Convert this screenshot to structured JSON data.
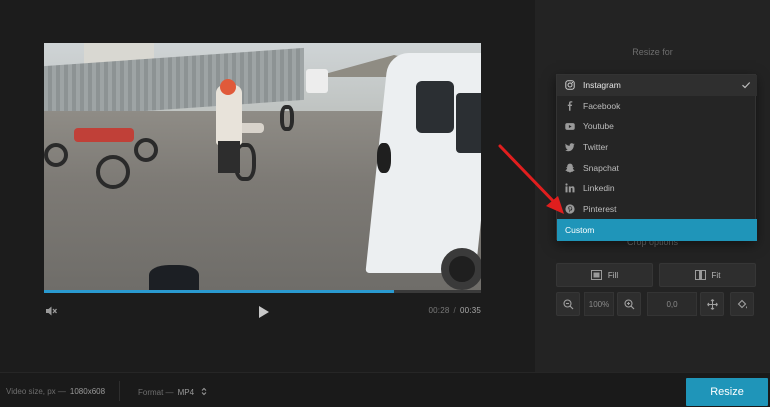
{
  "player": {
    "progress_percent": 80,
    "time_current": "00:28",
    "time_separator": "/",
    "time_total": "00:35"
  },
  "panel": {
    "resize_title": "Resize for",
    "crop_title": "Crop options",
    "fill_label": "Fill",
    "fit_label": "Fit",
    "zoom_value": "100%",
    "position_value": "0,0"
  },
  "dropdown": {
    "items": [
      {
        "label": "Instagram",
        "icon": "instagram-icon",
        "selected": true
      },
      {
        "label": "Facebook",
        "icon": "facebook-icon"
      },
      {
        "label": "Youtube",
        "icon": "youtube-icon"
      },
      {
        "label": "Twitter",
        "icon": "twitter-icon"
      },
      {
        "label": "Snapchat",
        "icon": "snapchat-icon"
      },
      {
        "label": "Linkedin",
        "icon": "linkedin-icon"
      },
      {
        "label": "Pinterest",
        "icon": "pinterest-icon"
      },
      {
        "label": "Custom",
        "icon": "",
        "highlighted": true
      }
    ]
  },
  "bottom": {
    "video_size_label": "Video size, px —",
    "video_size_value": "1080x608",
    "format_label": "Format —",
    "format_value": "MP4",
    "resize_button": "Resize"
  },
  "colors": {
    "accent": "#1f95b9",
    "progress": "#2a9ad0",
    "annotation_arrow": "#e01e1e"
  }
}
